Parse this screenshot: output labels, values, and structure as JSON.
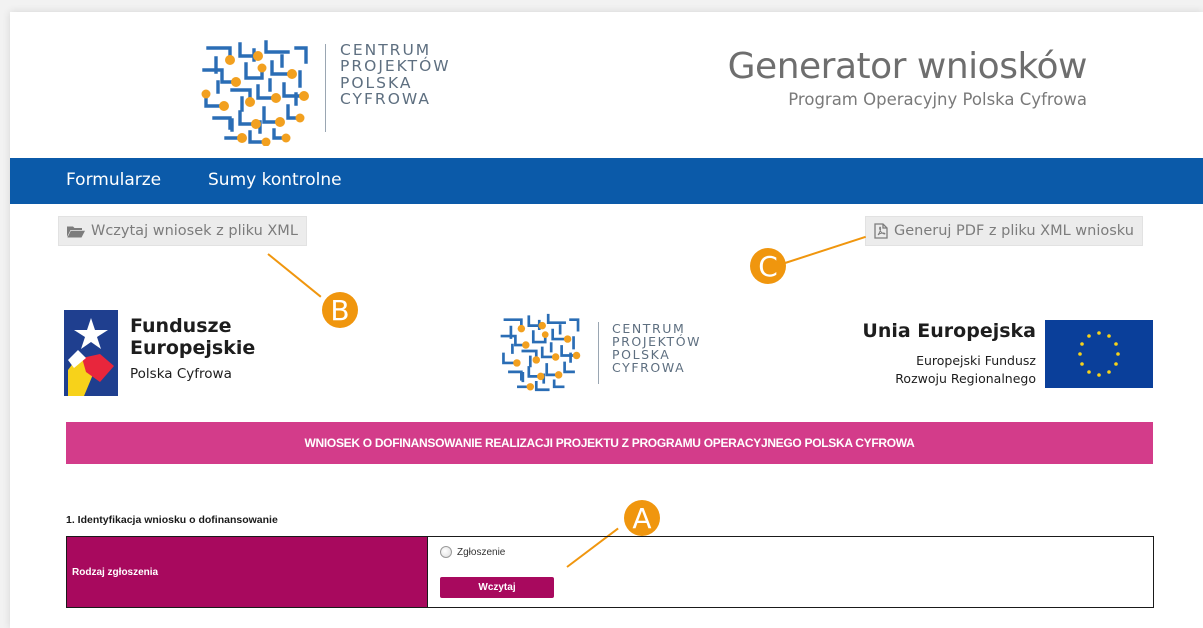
{
  "header": {
    "logo_lines": [
      "CENTRUM",
      "PROJEKTÓW",
      "POLSKA",
      "CYFROWA"
    ],
    "title": "Generator wniosków",
    "subtitle": "Program Operacyjny Polska Cyfrowa"
  },
  "nav": {
    "items": [
      {
        "label": "Formularze"
      },
      {
        "label": "Sumy kontrolne"
      }
    ]
  },
  "actions": {
    "load_xml_label": "Wczytaj wniosek z pliku XML",
    "load_xml_icon": "folder-open-icon",
    "generate_pdf_label": "Generuj PDF z pliku XML wniosku",
    "generate_pdf_icon": "pdf-file-icon"
  },
  "annotations": {
    "a": "A",
    "b": "B",
    "c": "C",
    "color": "#f0960e"
  },
  "logos": {
    "fe_title_line1": "Fundusze",
    "fe_title_line2": "Europejskie",
    "fe_subtitle": "Polska Cyfrowa",
    "cpp_lines": [
      "CENTRUM",
      "PROJEKTÓW",
      "POLSKA",
      "CYFROWA"
    ],
    "eu_title": "Unia Europejska",
    "eu_sub_line1": "Europejski Fundusz",
    "eu_sub_line2": "Rozwoju Regionalnego"
  },
  "banner": {
    "text": "WNIOSEK O DOFINANSOWANIE REALIZACJI PROJEKTU Z PROGRAMU OPERACYJNEGO POLSKA CYFROWA",
    "color": "#d33c8a"
  },
  "section1": {
    "heading": "1. Identyfikacja wniosku o dofinansowanie",
    "row_label": "Rodzaj zgłoszenia",
    "radio_label": "Zgłoszenie",
    "button_label": "Wczytaj",
    "accent_color": "#a8095e"
  },
  "colors": {
    "nav": "#0b5aa9",
    "logo_blue": "#2a6db5",
    "logo_orange": "#f2a01f"
  }
}
